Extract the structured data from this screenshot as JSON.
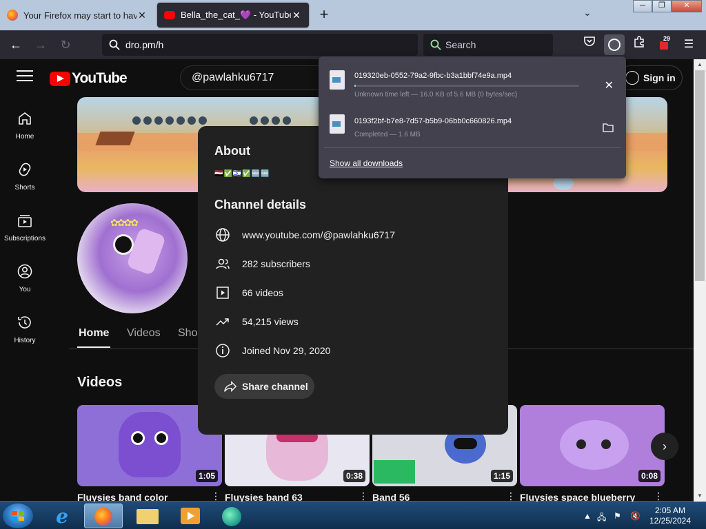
{
  "browser": {
    "tabs": [
      {
        "title": "Your Firefox may start to have p",
        "active": false
      },
      {
        "title": "Bella_the_cat_💜 - YouTube",
        "active": true
      }
    ],
    "new_tab": "+",
    "url": "dro.pm/h",
    "search_placeholder": "Search",
    "extension_badge": "29"
  },
  "youtube": {
    "logo_text": "YouTube",
    "search_value": "@pawlahku6717",
    "sign_in": "Sign in",
    "sidebar": [
      {
        "label": "Home",
        "icon": "home-icon"
      },
      {
        "label": "Shorts",
        "icon": "shorts-icon"
      },
      {
        "label": "Subscriptions",
        "icon": "subscriptions-icon"
      },
      {
        "label": "You",
        "icon": "you-icon"
      },
      {
        "label": "History",
        "icon": "history-icon"
      }
    ],
    "channel_tabs": [
      "Home",
      "Videos",
      "Sho"
    ],
    "videos_heading": "Videos",
    "videos": [
      {
        "title": "Fluysies band color",
        "duration": "1:05",
        "color": "#8e6fd8"
      },
      {
        "title": "Fluysies band 63",
        "duration": "0:38",
        "color": "#e8e6f0"
      },
      {
        "title": "Band 56",
        "duration": "1:15",
        "color": "#d9d9e2"
      },
      {
        "title": "Fluysies space blueberry",
        "duration": "0:08",
        "color": "#b07fdc"
      }
    ]
  },
  "about": {
    "title": "About",
    "description": "🇾🇪✅🇮🇱✅🆕🆕",
    "details_title": "Channel details",
    "details": [
      {
        "icon": "globe-icon",
        "text": "www.youtube.com/@pawlahku6717"
      },
      {
        "icon": "subscribers-icon",
        "text": "282 subscribers"
      },
      {
        "icon": "video-icon",
        "text": "66 videos"
      },
      {
        "icon": "trending-icon",
        "text": "54,215 views"
      },
      {
        "icon": "info-icon",
        "text": "Joined Nov 29, 2020"
      }
    ],
    "share": "Share channel"
  },
  "downloads": {
    "items": [
      {
        "name": "019320eb-0552-79a2-9fbc-b3a1bbf74e9a.mp4",
        "status": "Unknown time left — 16.0 KB of 5.6 MB (0 bytes/sec)",
        "progress": 0.003,
        "action": "cancel-icon"
      },
      {
        "name": "0193f2bf-b7e8-7d57-b5b9-06bb0c660826.mp4",
        "status": "Completed — 1.6 MB",
        "progress": 1,
        "action": "folder-icon"
      }
    ],
    "show_all": "Show all downloads"
  },
  "taskbar": {
    "time": "2:05 AM",
    "date": "12/25/2024"
  }
}
